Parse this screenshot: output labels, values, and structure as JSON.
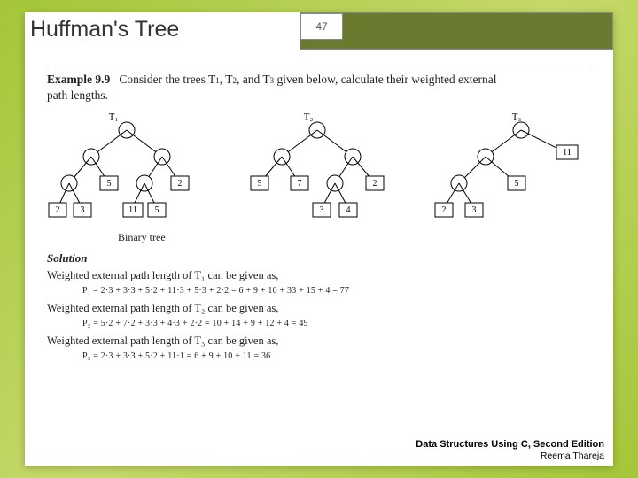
{
  "header": {
    "title": "Huffman's Tree",
    "page_number": "47"
  },
  "example": {
    "label": "Example 9.9",
    "prompt_a": "Consider the trees T",
    "prompt_b": ", T",
    "prompt_c": ", and T",
    "prompt_d": " given below, calculate their weighted external",
    "prompt_e": "path lengths.",
    "s1": "1",
    "s2": "2",
    "s3": "3"
  },
  "trees": {
    "t1": {
      "label": "T₁",
      "mid_l": "5",
      "mid_r": "2",
      "leaves": [
        "2",
        "3",
        "11",
        "5"
      ]
    },
    "t2": {
      "label": "T₂",
      "mid": [
        "5",
        "7",
        "2"
      ],
      "leaves": [
        "3",
        "4"
      ]
    },
    "t3": {
      "label": "T₃",
      "right": "11",
      "mid_r": "5",
      "leaves": [
        "2",
        "3"
      ]
    }
  },
  "caption": "Binary tree",
  "solution": {
    "heading": "Solution",
    "line1": "Weighted external path length of T₁ can be given as,",
    "eq1": "P₁ = 2·3 + 3·3 + 5·2 + 11·3 + 5·3 + 2·2 = 6 + 9 + 10 + 33 + 15 + 4 = 77",
    "line2": "Weighted external path length of T₂ can be given as,",
    "eq2": "P₂ = 5·2 + 7·2 + 3·3 + 4·3 + 2·2 = 10 + 14 + 9 + 12 + 4 = 49",
    "line3": "Weighted external path length of T₃ can be given as,",
    "eq3": "P₃ = 2·3 + 3·3 + 5·2 + 11·1 = 6 + 9 + 10 + 11 = 36"
  },
  "footer": {
    "book": "Data Structures Using C, Second Edition",
    "author": "Reema Thareja"
  }
}
